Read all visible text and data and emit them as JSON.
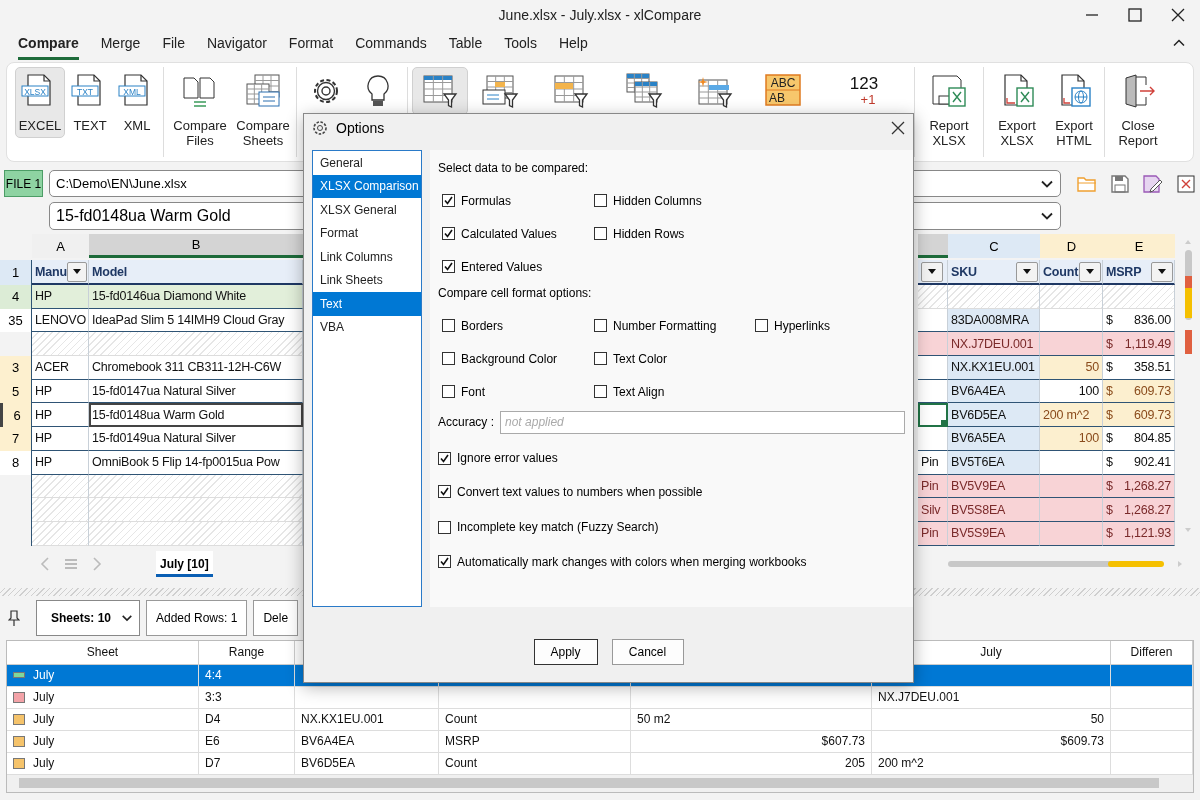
{
  "window": {
    "title": "June.xlsx - July.xlsx - xlCompare"
  },
  "menu": [
    {
      "label": "Compare",
      "selected": true
    },
    {
      "label": "Merge",
      "selected": false
    },
    {
      "label": "File",
      "selected": false
    },
    {
      "label": "Navigator",
      "selected": false
    },
    {
      "label": "Format",
      "selected": false
    },
    {
      "label": "Commands",
      "selected": false
    },
    {
      "label": "Table",
      "selected": false
    },
    {
      "label": "Tools",
      "selected": false
    },
    {
      "label": "Help",
      "selected": false
    }
  ],
  "ribbon": {
    "groups": [
      {
        "buttons": [
          {
            "kind": "file",
            "icon_text": "XLSX",
            "label": "EXCEL",
            "selected": true
          },
          {
            "kind": "file",
            "icon_text": "TXT",
            "label": "TEXT",
            "selected": false
          },
          {
            "kind": "file",
            "icon_text": "XML",
            "label": "XML",
            "selected": false
          }
        ]
      },
      {
        "buttons": [
          {
            "kind": "files",
            "label": "Compare Files",
            "selected": false
          },
          {
            "kind": "sheets",
            "label": "Compare Sheets",
            "selected": false
          }
        ]
      },
      {
        "buttons": [
          {
            "kind": "gear",
            "selected": false
          },
          {
            "kind": "bulb",
            "selected": false
          }
        ]
      },
      {
        "buttons": [
          {
            "kind": "table",
            "selected": true
          },
          {
            "kind": "form",
            "selected": false
          },
          {
            "kind": "row",
            "selected": false
          },
          {
            "kind": "stack",
            "selected": false
          },
          {
            "kind": "spark",
            "selected": false
          },
          {
            "kind": "abc",
            "icon_text": "ABC",
            "icon_subtext": "AB",
            "selected": false
          },
          {
            "kind": "numbers",
            "icon_text": "123",
            "icon_subtext": "+1",
            "selected": false
          }
        ]
      },
      {
        "buttons": [
          {
            "kind": "report",
            "label": "Report XLSX",
            "selected": false
          }
        ]
      },
      {
        "buttons": [
          {
            "kind": "xlsx",
            "label": "Export XLSX",
            "selected": false
          },
          {
            "kind": "html",
            "label": "Export HTML",
            "selected": false
          }
        ]
      },
      {
        "buttons": [
          {
            "kind": "door",
            "label": "Close Report",
            "selected": false
          }
        ]
      }
    ]
  },
  "file_bar": {
    "badge": "FILE 1",
    "path": "C:\\Demo\\EN\\June.xlsx",
    "cell_value": "15-fd0148ua Warm Gold"
  },
  "sheet": {
    "columns": {
      "left": [
        {
          "label": "A",
          "kind": "plain"
        },
        {
          "label": "B",
          "kind": "selected"
        }
      ],
      "right": [
        {
          "kind": "selected"
        },
        {
          "label": "C",
          "kind": "key"
        },
        {
          "label": "D",
          "kind": "changed"
        },
        {
          "label": "E",
          "kind": "changed"
        }
      ]
    },
    "header_row": {
      "number": "1",
      "left": [
        {
          "text": "Manu",
          "filter": true
        },
        {
          "text": "Model",
          "filter": false
        }
      ],
      "right": [
        {
          "filter": true
        },
        {
          "text": "SKU",
          "filter": true
        },
        {
          "text": "Count",
          "filter": true
        },
        {
          "text": "MSRP",
          "filter": true
        }
      ]
    },
    "rows": [
      {
        "number": "4",
        "added": true,
        "changed": false,
        "current": false,
        "left": {
          "kind": "data",
          "cells": [
            "HP",
            "15-fd0146ua Diamond White"
          ]
        },
        "right": {
          "kind": "blank"
        }
      },
      {
        "number": "35",
        "added": false,
        "changed": false,
        "current": false,
        "left": {
          "kind": "data",
          "cells": [
            "LENOVO",
            "IdeaPad Slim 5 14IMH9 Cloud Gray"
          ]
        },
        "right": {
          "kind": "data",
          "removed": false,
          "cells": [
            {
              "changed": false
            },
            {
              "text": "83DA008MRA",
              "changed": false
            },
            {
              "changed": false
            },
            {
              "currency": "$",
              "amount": "836.00",
              "changed": false
            }
          ]
        }
      },
      {
        "current": false,
        "left": {
          "kind": "blank"
        },
        "right": {
          "kind": "data",
          "removed": true,
          "cells": [
            {},
            {
              "text": "NX.J7DEU.001"
            },
            {},
            {
              "currency": "$",
              "amount": "1,119.49"
            }
          ]
        }
      },
      {
        "number": "3",
        "added": false,
        "changed": true,
        "current": false,
        "left": {
          "kind": "data",
          "cells": [
            "ACER",
            "Chromebook 311 CB311-12H-C6W"
          ]
        },
        "right": {
          "kind": "data",
          "removed": false,
          "cells": [
            {
              "changed": false
            },
            {
              "text": "NX.KX1EU.001",
              "changed": false
            },
            {
              "text": "50",
              "numeric": true,
              "changed": true
            },
            {
              "currency": "$",
              "amount": "358.51",
              "changed": false
            }
          ]
        }
      },
      {
        "number": "5",
        "added": false,
        "changed": true,
        "current": false,
        "left": {
          "kind": "data",
          "cells": [
            "HP",
            "15-fd0147ua Natural Silver"
          ]
        },
        "right": {
          "kind": "data",
          "removed": false,
          "cells": [
            {
              "changed": false
            },
            {
              "text": "BV6A4EA",
              "changed": false
            },
            {
              "text": "100",
              "numeric": true,
              "changed": false
            },
            {
              "currency": "$",
              "amount": "609.73",
              "changed": true
            }
          ]
        }
      },
      {
        "number": "6",
        "added": false,
        "changed": true,
        "current": true,
        "left": {
          "kind": "data",
          "cells": [
            "HP",
            "15-fd0148ua Warm Gold"
          ]
        },
        "right": {
          "kind": "data",
          "removed": false,
          "cells": [
            {
              "changed": false
            },
            {
              "text": "BV6D5EA",
              "changed": false
            },
            {
              "text": "200 m^2",
              "changed": true
            },
            {
              "currency": "$",
              "amount": "609.73",
              "changed": true
            }
          ]
        }
      },
      {
        "number": "7",
        "added": false,
        "changed": true,
        "current": false,
        "left": {
          "kind": "data",
          "cells": [
            "HP",
            "15-fd0149ua Natural Silver"
          ]
        },
        "right": {
          "kind": "data",
          "removed": false,
          "cells": [
            {
              "changed": false
            },
            {
              "text": "BV6A5EA",
              "changed": false
            },
            {
              "text": "100",
              "numeric": true,
              "changed": true
            },
            {
              "currency": "$",
              "amount": "804.85",
              "changed": false
            }
          ]
        }
      },
      {
        "number": "8",
        "added": false,
        "changed": false,
        "current": false,
        "left": {
          "kind": "data",
          "cells": [
            "HP",
            "OmniBook 5 Flip 14-fp0015ua Pow"
          ]
        },
        "right": {
          "kind": "data",
          "removed": false,
          "cells": [
            {
              "text": "Pin",
              "changed": false
            },
            {
              "text": "BV5T6EA",
              "changed": false
            },
            {
              "changed": false
            },
            {
              "currency": "$",
              "amount": "902.41",
              "changed": false
            }
          ]
        }
      },
      {
        "current": false,
        "left": {
          "kind": "blank"
        },
        "right": {
          "kind": "data",
          "removed": true,
          "cells": [
            {
              "text": "Pin"
            },
            {
              "text": "BV5V9EA"
            },
            {},
            {
              "currency": "$",
              "amount": "1,268.27"
            }
          ]
        }
      },
      {
        "current": false,
        "left": {
          "kind": "blank"
        },
        "right": {
          "kind": "data",
          "removed": true,
          "cells": [
            {
              "text": "Silv"
            },
            {
              "text": "BV5S8EA"
            },
            {},
            {
              "currency": "$",
              "amount": "1,268.27"
            }
          ]
        }
      },
      {
        "current": false,
        "left": {
          "kind": "blank"
        },
        "right": {
          "kind": "data",
          "removed": true,
          "cells": [
            {
              "text": "Pin"
            },
            {
              "text": "BV5S9EA"
            },
            {},
            {
              "currency": "$",
              "amount": "1,121.93"
            }
          ]
        }
      }
    ],
    "tabs": [
      {
        "label": "July [10]",
        "selected": true
      }
    ]
  },
  "report": {
    "sheets_select": "Sheets: 10",
    "buttons": [
      "Added Rows: 1",
      "Dele"
    ],
    "columns": {
      "sheet": "Sheet",
      "range": "Range",
      "july": "July",
      "column_7": "Differen"
    },
    "rows": [
      {
        "color": "#7fd89a",
        "selected": true,
        "cells": {
          "sheet": "July",
          "range": "4:4"
        }
      },
      {
        "color": "#f3a3a8",
        "selected": false,
        "cells": {
          "sheet": "July",
          "range": "3:3",
          "july": "NX.J7DEU.001"
        }
      },
      {
        "color": "#f5c36b",
        "selected": false,
        "cells": {
          "sheet": "July",
          "range": "D4",
          "column_3": "NX.KX1EU.001",
          "column_4": "Count",
          "column_5": "50 m2",
          "july": {
            "text": "50",
            "numeric": true
          }
        }
      },
      {
        "color": "#f5c36b",
        "selected": false,
        "cells": {
          "sheet": "July",
          "range": "E6",
          "column_3": "BV6A4EA",
          "column_4": "MSRP",
          "column_5": {
            "text": "$607.73",
            "numeric": true
          },
          "july": {
            "text": "$609.73",
            "numeric": true
          }
        }
      },
      {
        "color": "#f5c36b",
        "selected": false,
        "cells": {
          "sheet": "July",
          "range": "D7",
          "column_3": "BV6D5EA",
          "column_4": "Count",
          "column_5": {
            "text": "205",
            "numeric": true
          },
          "july": "200 m^2"
        }
      }
    ]
  },
  "dialog": {
    "title": "Options",
    "sections": [
      {
        "label": "General",
        "selected": false
      },
      {
        "label": "XLSX Comparison",
        "selected": true
      },
      {
        "label": "XLSX General",
        "selected": false
      },
      {
        "label": "Format",
        "selected": false
      },
      {
        "label": "Link Columns",
        "selected": false
      },
      {
        "label": "Link Sheets",
        "selected": false
      },
      {
        "label": "Text",
        "selected": true
      },
      {
        "label": "VBA",
        "selected": false
      }
    ],
    "data_heading": "Select data to be compared:",
    "data_options": [
      [
        {
          "label": "Formulas",
          "checked": true
        },
        {
          "label": "Hidden Columns",
          "checked": false
        }
      ],
      [
        {
          "label": "Calculated Values",
          "checked": true
        },
        {
          "label": "Hidden Rows",
          "checked": false
        }
      ],
      [
        {
          "label": "Entered Values",
          "checked": true
        }
      ]
    ],
    "format_heading": "Compare cell format options:",
    "format_options": [
      [
        {
          "label": "Borders",
          "checked": false
        },
        {
          "label": "Number Formatting",
          "checked": false
        },
        {
          "label": "Hyperlinks",
          "checked": false
        }
      ],
      [
        {
          "label": "Background Color",
          "checked": false
        },
        {
          "label": "Text Color",
          "checked": false
        }
      ],
      [
        {
          "label": "Font",
          "checked": false
        },
        {
          "label": "Text Align",
          "checked": false
        }
      ]
    ],
    "accuracy": {
      "label": "Accuracy :",
      "placeholder": "not applied"
    },
    "extra_options": [
      {
        "label": "Ignore error values",
        "checked": true
      },
      {
        "label": "Convert text values to numbers when possible",
        "checked": true
      },
      {
        "label": "Incomplete key match (Fuzzy Search)",
        "checked": false
      },
      {
        "label": "Automatically mark changes with colors when merging workbooks",
        "checked": true
      }
    ],
    "buttons": [
      "Apply",
      "Cancel"
    ]
  }
}
